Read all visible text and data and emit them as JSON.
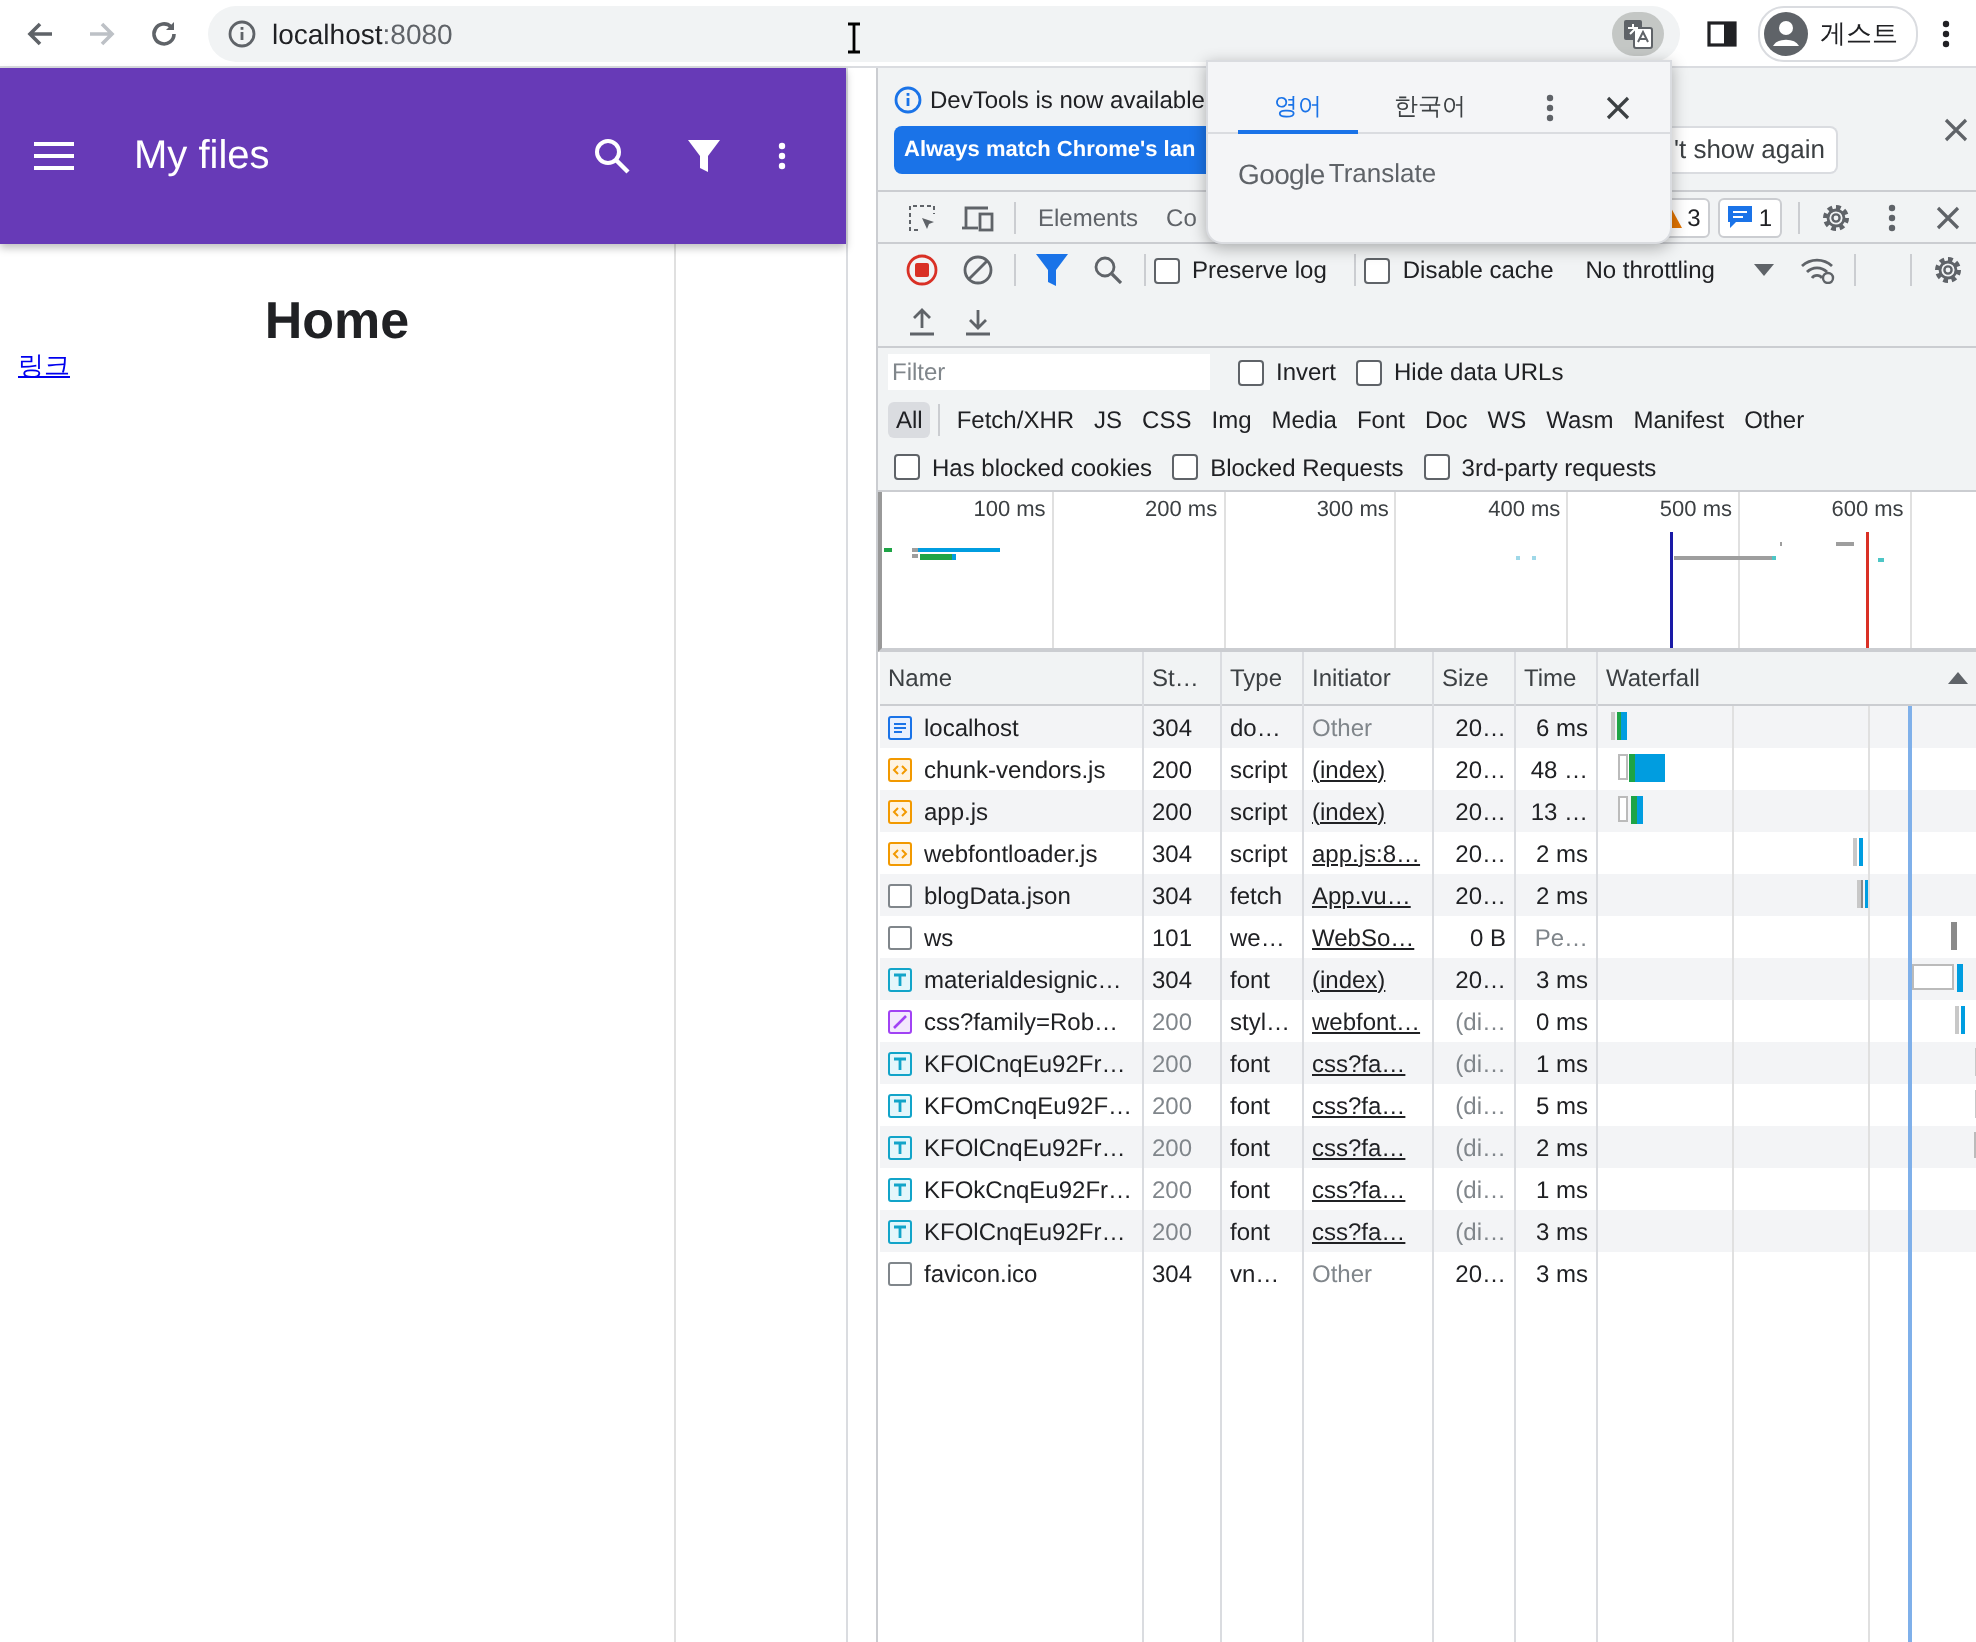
{
  "browser": {
    "nav": [
      {
        "kind": "back",
        "disabled": false
      },
      {
        "kind": "forward",
        "disabled": true
      },
      {
        "kind": "reload",
        "disabled": false
      }
    ],
    "address": {
      "host": "localhost",
      "port": ":8080"
    },
    "translate_active": true,
    "profile": "게스트"
  },
  "page": {
    "app_bar": {
      "title": "My files"
    },
    "heading": "Home",
    "link": "링크"
  },
  "translate_popup": {
    "tabs": [
      {
        "label": "영어",
        "selected": true
      },
      {
        "label": "한국어",
        "selected": false
      }
    ],
    "brand": "Google",
    "product": "Translate"
  },
  "devtools": {
    "banner": {
      "message": "DevTools is now available",
      "primary_button": "Always match Chrome's lan",
      "secondary_button": "'t show again"
    },
    "tabs": [
      {
        "label": "Elements",
        "selected": false
      },
      {
        "label": "Co",
        "selected": false
      }
    ],
    "issues": {
      "warnings": "3",
      "messages": "1"
    },
    "toolbar": {
      "recording": true,
      "filter_active": true,
      "checkboxes": [
        {
          "label": "Preserve log",
          "checked": false
        },
        {
          "label": "Disable cache",
          "checked": false
        }
      ],
      "throttling": "No throttling"
    },
    "filter": {
      "placeholder": "Filter",
      "checkboxes": [
        {
          "label": "Invert",
          "checked": false
        },
        {
          "label": "Hide data URLs",
          "checked": false
        }
      ]
    },
    "types": [
      {
        "label": "All",
        "selected": true
      },
      {
        "label": "Fetch/XHR",
        "selected": false
      },
      {
        "label": "JS",
        "selected": false
      },
      {
        "label": "CSS",
        "selected": false
      },
      {
        "label": "Img",
        "selected": false
      },
      {
        "label": "Media",
        "selected": false
      },
      {
        "label": "Font",
        "selected": false
      },
      {
        "label": "Doc",
        "selected": false
      },
      {
        "label": "WS",
        "selected": false
      },
      {
        "label": "Wasm",
        "selected": false
      },
      {
        "label": "Manifest",
        "selected": false
      },
      {
        "label": "Other",
        "selected": false
      }
    ],
    "blocked": [
      {
        "label": "Has blocked cookies",
        "checked": false
      },
      {
        "label": "Blocked Requests",
        "checked": false
      },
      {
        "label": "3rd-party requests",
        "checked": false
      }
    ],
    "overview": {
      "ticks": [
        "100 ms",
        "200 ms",
        "300 ms",
        "400 ms",
        "500 ms",
        "600 ms"
      ]
    },
    "table": {
      "columns": [
        {
          "label": "Name",
          "sorted": false
        },
        {
          "label": "St…",
          "sorted": false
        },
        {
          "label": "Type",
          "sorted": false
        },
        {
          "label": "Initiator",
          "sorted": false
        },
        {
          "label": "Size",
          "sorted": false
        },
        {
          "label": "Time",
          "sorted": false
        },
        {
          "label": "Waterfall",
          "sorted": true
        }
      ],
      "rows": [
        {
          "kind": "document",
          "name": "localhost",
          "status": "304",
          "type": "do…",
          "initiator": "Other",
          "initiator_link": false,
          "size": "20…",
          "time": "6 ms",
          "cached": false,
          "pending": false
        },
        {
          "kind": "script",
          "name": "chunk-vendors.js",
          "status": "200",
          "type": "script",
          "initiator": "(index)",
          "initiator_link": true,
          "size": "20…",
          "time": "48 …",
          "cached": false,
          "pending": false
        },
        {
          "kind": "script",
          "name": "app.js",
          "status": "200",
          "type": "script",
          "initiator": "(index)",
          "initiator_link": true,
          "size": "20…",
          "time": "13 …",
          "cached": false,
          "pending": false
        },
        {
          "kind": "script",
          "name": "webfontloader.js",
          "status": "304",
          "type": "script",
          "initiator": "app.js:8…",
          "initiator_link": true,
          "size": "20…",
          "time": "2 ms",
          "cached": false,
          "pending": false
        },
        {
          "kind": "other",
          "name": "blogData.json",
          "status": "304",
          "type": "fetch",
          "initiator": "App.vu…",
          "initiator_link": true,
          "size": "20…",
          "time": "2 ms",
          "cached": false,
          "pending": false
        },
        {
          "kind": "other",
          "name": "ws",
          "status": "101",
          "type": "we…",
          "initiator": "WebSo…",
          "initiator_link": true,
          "size": "0 B",
          "time": "Pe…",
          "cached": false,
          "pending": true
        },
        {
          "kind": "font",
          "name": "materialdesignic…",
          "status": "304",
          "type": "font",
          "initiator": "(index)",
          "initiator_link": true,
          "size": "20…",
          "time": "3 ms",
          "cached": false,
          "pending": false
        },
        {
          "kind": "stylesheet",
          "name": "css?family=Rob…",
          "status": "200",
          "type": "styl…",
          "initiator": "webfont…",
          "initiator_link": true,
          "size": "(di…",
          "time": "0 ms",
          "cached": true,
          "pending": false
        },
        {
          "kind": "font",
          "name": "KFOlCnqEu92Fr…",
          "status": "200",
          "type": "font",
          "initiator": "css?fa…",
          "initiator_link": true,
          "size": "(di…",
          "time": "1 ms",
          "cached": true,
          "pending": false
        },
        {
          "kind": "font",
          "name": "KFOmCnqEu92F…",
          "status": "200",
          "type": "font",
          "initiator": "css?fa…",
          "initiator_link": true,
          "size": "(di…",
          "time": "5 ms",
          "cached": true,
          "pending": false
        },
        {
          "kind": "font",
          "name": "KFOlCnqEu92Fr…",
          "status": "200",
          "type": "font",
          "initiator": "css?fa…",
          "initiator_link": true,
          "size": "(di…",
          "time": "2 ms",
          "cached": true,
          "pending": false
        },
        {
          "kind": "font",
          "name": "KFOkCnqEu92Fr…",
          "status": "200",
          "type": "font",
          "initiator": "css?fa…",
          "initiator_link": true,
          "size": "(di…",
          "time": "1 ms",
          "cached": true,
          "pending": false
        },
        {
          "kind": "font",
          "name": "KFOlCnqEu92Fr…",
          "status": "200",
          "type": "font",
          "initiator": "css?fa…",
          "initiator_link": true,
          "size": "(di…",
          "time": "3 ms",
          "cached": true,
          "pending": false
        },
        {
          "kind": "other",
          "name": "favicon.ico",
          "status": "304",
          "type": "vn…",
          "initiator": "Other",
          "initiator_link": false,
          "size": "20…",
          "time": "3 ms",
          "cached": false,
          "pending": false
        }
      ]
    }
  }
}
